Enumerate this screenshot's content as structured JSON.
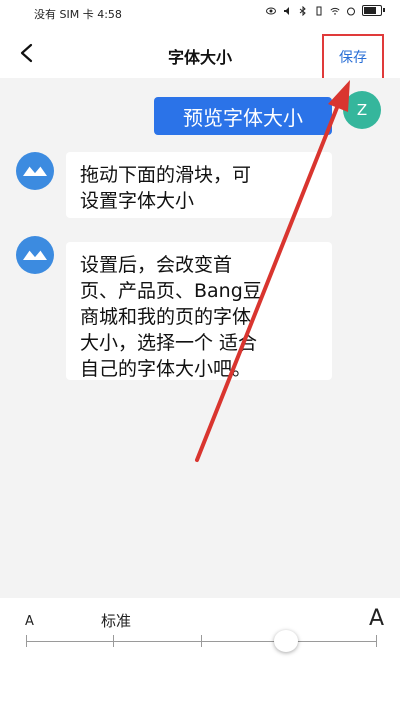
{
  "status_bar": {
    "carrier": "没有 SIM 卡",
    "time": "4:58"
  },
  "header": {
    "title": "字体大小",
    "save_label": "保存"
  },
  "chat": {
    "user_message": "预览字体大小",
    "user_avatar_initial": "Z",
    "bot_messages": [
      {
        "lines": [
          "拖动下面的滑块，可",
          "设置字体大小"
        ]
      },
      {
        "lines": [
          "设置后，会改变首",
          "页、产品页、Bang豆",
          "商城和我的页的字体",
          "大小，选择一个 适合",
          "自己的字体大小吧。"
        ]
      }
    ]
  },
  "font_slider": {
    "small_label": "A",
    "standard_label": "标准",
    "large_label": "A",
    "steps": 5,
    "selected_step_fraction": 0.75
  },
  "colors": {
    "accent_blue": "#2b73e8",
    "save_text": "#2a6fd6",
    "highlight_red": "#e03a3a",
    "avatar_green": "#35b69c"
  }
}
